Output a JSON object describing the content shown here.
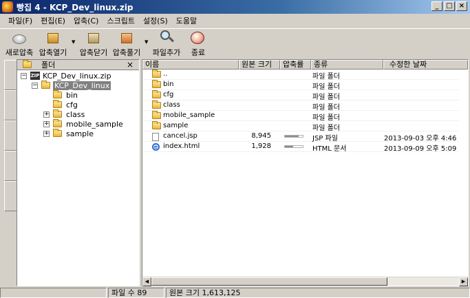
{
  "window": {
    "title": "빵집 4 - KCP_Dev_linux.zip",
    "buttons": [
      "_",
      "□",
      "×"
    ]
  },
  "menu": [
    "파일(F)",
    "편집(E)",
    "압축(C)",
    "스크립트",
    "설정(S)",
    "도움말"
  ],
  "toolbar": {
    "new": "새로압축",
    "open": "압축열기",
    "close": "압축닫기",
    "extract": "압축풀기",
    "add": "파일추가",
    "exit": "종료"
  },
  "folder_pane": {
    "header": "폴더",
    "close_glyph": "×",
    "tree": {
      "root": "KCP_Dev_linux.zip",
      "root_icon_text": "ZIP",
      "selected": "KCP_Dev_linux",
      "children": [
        "bin",
        "cfg",
        "class",
        "mobile_sample",
        "sample"
      ]
    }
  },
  "file_list": {
    "columns": [
      "이름",
      "원본 크기",
      "압축률",
      "종류",
      "수정한 날짜"
    ],
    "rows": [
      {
        "name": "..",
        "size": "",
        "ratio": null,
        "type": "파일 폴더",
        "date": ""
      },
      {
        "name": "bin",
        "size": "",
        "ratio": null,
        "type": "파일 폴더",
        "date": ""
      },
      {
        "name": "cfg",
        "size": "",
        "ratio": null,
        "type": "파일 폴더",
        "date": ""
      },
      {
        "name": "class",
        "size": "",
        "ratio": null,
        "type": "파일 폴더",
        "date": ""
      },
      {
        "name": "mobile_sample",
        "size": "",
        "ratio": null,
        "type": "파일 폴더",
        "date": ""
      },
      {
        "name": "sample",
        "size": "",
        "ratio": null,
        "type": "파일 폴더",
        "date": ""
      },
      {
        "name": "cancel.jsp",
        "size": "8,945",
        "ratio": 0.75,
        "type": "JSP 파일",
        "date": "2013-09-03 오후 4:46"
      },
      {
        "name": "index.html",
        "size": "1,928",
        "ratio": 0.45,
        "type": "HTML 문서",
        "date": "2013-09-09 오후 5:09"
      }
    ]
  },
  "status": {
    "file_count": "파일 수 89",
    "original_size": "원본 크기 1,613,125"
  },
  "colors": {
    "title_start": "#0a246a",
    "title_end": "#a6caf0",
    "face": "#d4d0c8",
    "selection": "#808080"
  }
}
